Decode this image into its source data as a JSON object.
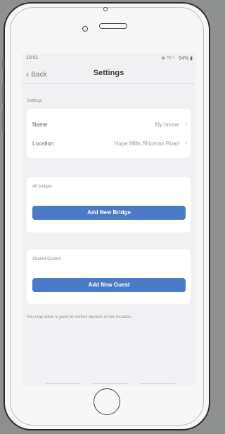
{
  "status_bar": {
    "time": "10:01",
    "right": "✲ ⁰⁰⁄ ⁵ ᐧ 94% ▮"
  },
  "nav": {
    "back_label": "Back",
    "title": "Settings"
  },
  "settings_section": {
    "label": "Settings",
    "rows": [
      {
        "key": "Name",
        "value": "My house"
      },
      {
        "key": "Location",
        "value": "Hope Mills,Shipman Road"
      }
    ]
  },
  "bridges_section": {
    "label": "All bridges",
    "button": "Add New Bridge"
  },
  "shared_section": {
    "label": "Shared Control",
    "button": "Add New Guest"
  },
  "footer_note": "You may allow a guest to control devices in this location."
}
